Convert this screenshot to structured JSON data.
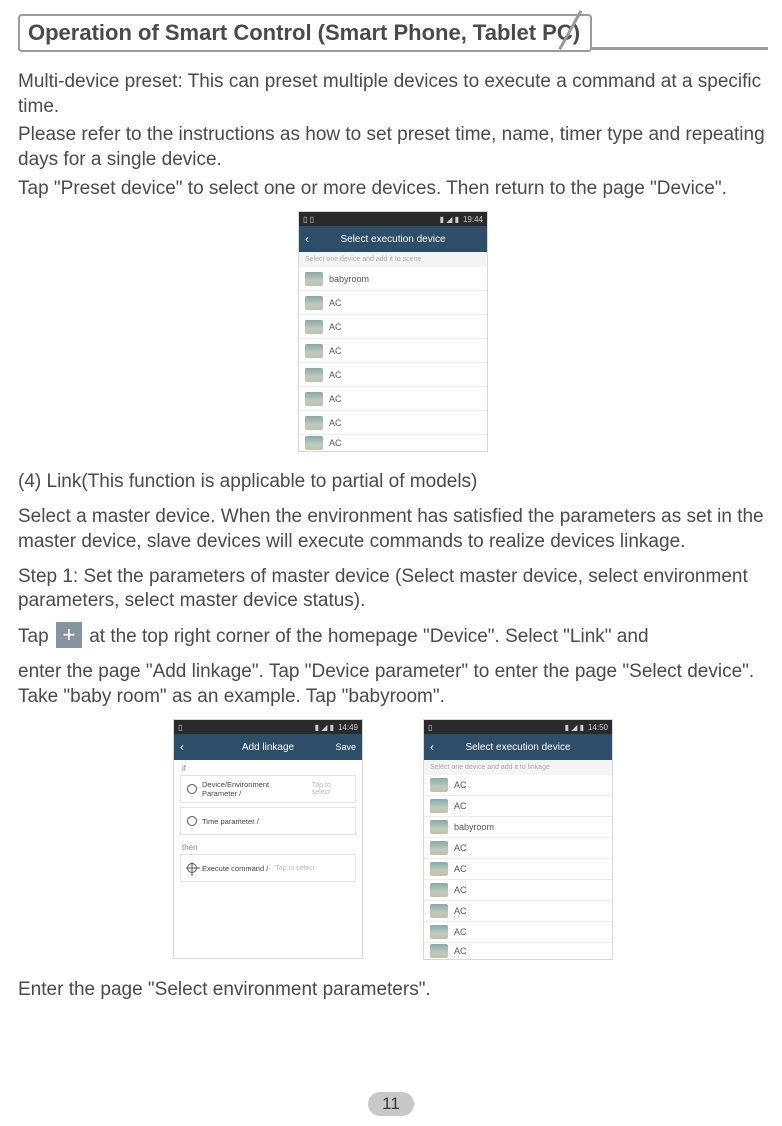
{
  "page_title": "Operation of Smart Control (Smart Phone, Tablet PC)",
  "para1": "Multi-device preset: This can preset multiple devices to execute a command at a specific time.",
  "para2": "Please refer to the instructions as how to set preset time, name, timer type and repeating days for a single device.",
  "para3": "Tap \"Preset device\" to select one or more devices. Then return to the page \"Device\".",
  "screenshot1": {
    "time": "19:44",
    "nav_title": "Select execution device",
    "hint": "Select one device and add it to scene",
    "items": [
      "babyroom",
      "AC",
      "AC",
      "AC",
      "AC",
      "AC",
      "AC",
      "AC"
    ]
  },
  "para4": "(4) Link(This function is applicable to partial of models)",
  "para5": "Select a master device. When the environment has satisfied the parameters as set in the master device, slave devices will execute commands to realize devices linkage.",
  "para6": "Step 1: Set the parameters of master device (Select master device, select environment parameters, select master device status).",
  "para7a": "Tap ",
  "para7b": " at the top right corner of the homepage \"Device\". Select \"Link\" and",
  "para8": "enter the page \"Add linkage\". Tap \"Device parameter\" to enter the page \"Select device\". Take \"baby room\" as an example. Tap \"babyroom\".",
  "screenshot2": {
    "time": "14:49",
    "nav_title": "Add linkage",
    "nav_right": "Save",
    "section_if": "if",
    "row1_label": "Device/Environment Parameter /",
    "row1_hint": "Tap to select",
    "row2_label": "Time parameter /",
    "section_then": "then",
    "row3_label": "Execute command /",
    "row3_hint": "Tap to select"
  },
  "screenshot3": {
    "time": "14:50",
    "nav_title": "Select execution device",
    "hint": "Select one device and add it to linkage",
    "items": [
      "AC",
      "AC",
      "babyroom",
      "AC",
      "AC",
      "AC",
      "AC",
      "AC",
      "AC"
    ]
  },
  "para9": "Enter the page \"Select environment parameters\".",
  "page_number": "11",
  "plus_glyph": "+"
}
